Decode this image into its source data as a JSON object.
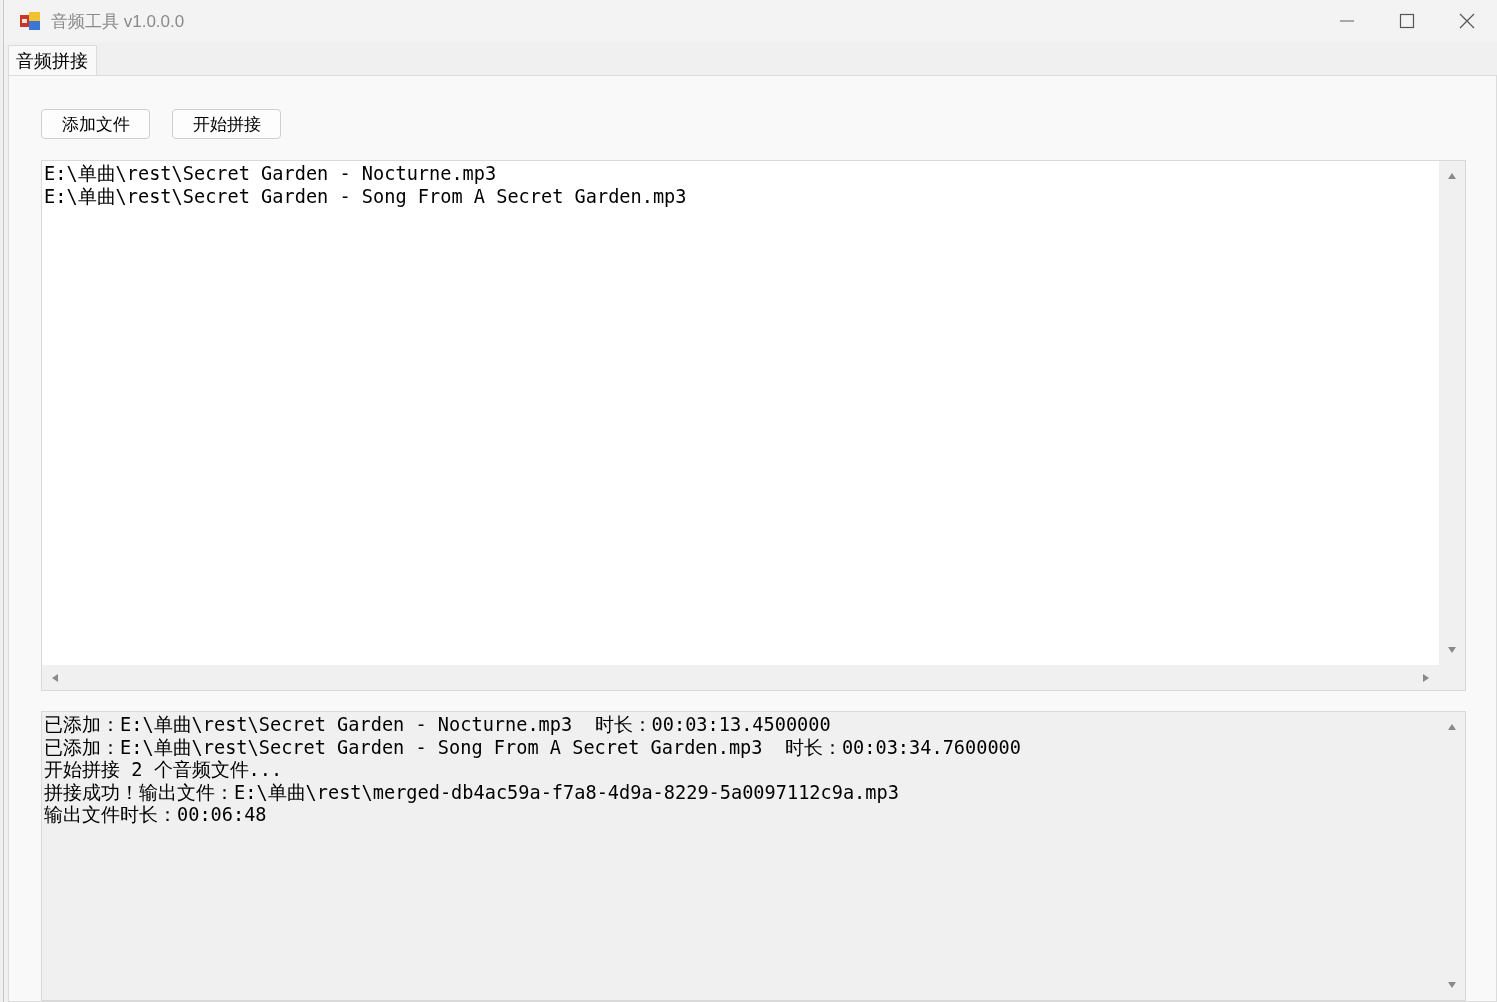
{
  "window": {
    "title": "音频工具 v1.0.0.0"
  },
  "tabs": [
    {
      "label": "音频拼接",
      "selected": true
    }
  ],
  "buttons": [
    {
      "label": "添加文件"
    },
    {
      "label": "开始拼接"
    }
  ],
  "file_list": {
    "lines": [
      "E:\\单曲\\rest\\Secret Garden - Nocturne.mp3",
      "E:\\单曲\\rest\\Secret Garden - Song From A Secret Garden.mp3"
    ]
  },
  "log": {
    "lines": [
      "已添加：E:\\单曲\\rest\\Secret Garden - Nocturne.mp3  时长：00:03:13.4500000",
      "已添加：E:\\单曲\\rest\\Secret Garden - Song From A Secret Garden.mp3  时长：00:03:34.7600000",
      "开始拼接 2 个音频文件...",
      "拼接成功！输出文件：E:\\单曲\\rest\\merged-db4ac59a-f7a8-4d9a-8229-5a0097112c9a.mp3",
      "输出文件时长：00:06:48"
    ]
  }
}
